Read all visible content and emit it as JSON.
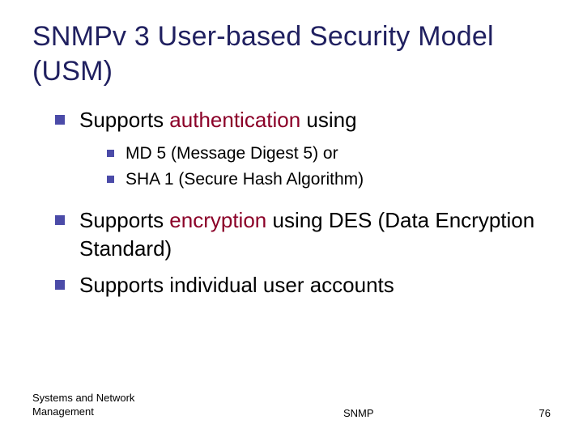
{
  "title": "SNMPv 3 User-based Security Model (USM)",
  "bullets": {
    "b1_pre": "Supports ",
    "b1_hl": "authentication",
    "b1_post": " using",
    "s1": "MD 5 (Message Digest 5) or",
    "s2": "SHA 1 (Secure Hash Algorithm)",
    "b2_pre": "Supports ",
    "b2_hl": "encryption",
    "b2_post": " using DES (Data Encryption Standard)",
    "b3": "Supports individual user accounts"
  },
  "footer": {
    "left": "Systems and Network Management",
    "center": "SNMP",
    "page": "76"
  }
}
